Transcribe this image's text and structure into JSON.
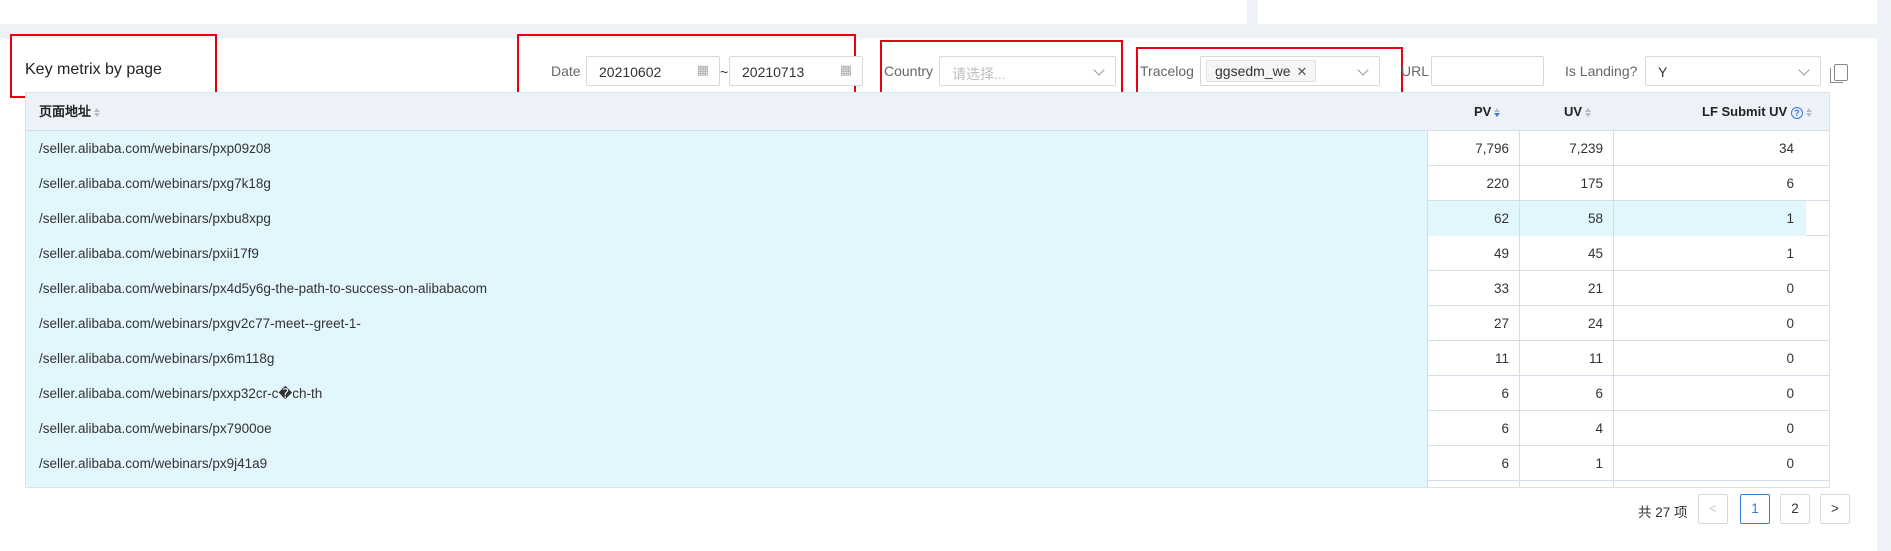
{
  "header": {
    "title": "Key metrix by page"
  },
  "filters": {
    "date_label": "Date",
    "date_from": "20210602",
    "date_separator": "~",
    "date_to": "20210713",
    "country_label": "Country",
    "country_placeholder": "请选择...",
    "tracelog_label": "Tracelog",
    "tracelog_tag": "ggsedm_we",
    "url_label": "URL",
    "url_value": "",
    "landing_label": "Is Landing?",
    "landing_value": "Y"
  },
  "table": {
    "columns": {
      "url": "页面地址",
      "pv": "PV",
      "uv": "UV",
      "lf": "LF Submit UV"
    },
    "rows": [
      {
        "url": "/seller.alibaba.com/webinars/pxp09z08",
        "pv": "7,796",
        "uv": "7,239",
        "lf": "34"
      },
      {
        "url": "/seller.alibaba.com/webinars/pxg7k18g",
        "pv": "220",
        "uv": "175",
        "lf": "6"
      },
      {
        "url": "/seller.alibaba.com/webinars/pxbu8xpg",
        "pv": "62",
        "uv": "58",
        "lf": "1"
      },
      {
        "url": "/seller.alibaba.com/webinars/pxii17f9",
        "pv": "49",
        "uv": "45",
        "lf": "1"
      },
      {
        "url": "/seller.alibaba.com/webinars/px4d5y6g-the-path-to-success-on-alibabacom",
        "pv": "33",
        "uv": "21",
        "lf": "0"
      },
      {
        "url": "/seller.alibaba.com/webinars/pxgv2c77-meet--greet-1-",
        "pv": "27",
        "uv": "24",
        "lf": "0"
      },
      {
        "url": "/seller.alibaba.com/webinars/px6m118g",
        "pv": "11",
        "uv": "11",
        "lf": "0"
      },
      {
        "url": "/seller.alibaba.com/webinars/pxxp32cr-c�ch-th",
        "pv": "6",
        "uv": "6",
        "lf": "0"
      },
      {
        "url": "/seller.alibaba.com/webinars/px7900oe",
        "pv": "6",
        "uv": "4",
        "lf": "0"
      },
      {
        "url": "/seller.alibaba.com/webinars/px9j41a9",
        "pv": "6",
        "uv": "1",
        "lf": "0"
      }
    ]
  },
  "pagination": {
    "total_text": "共 27 项",
    "prev": "<",
    "pages": [
      "1",
      "2"
    ],
    "active_page": "1",
    "next": ">"
  },
  "icons": {
    "calendar": "calendar-icon",
    "chevron": "chevron-down-icon",
    "close": "close-icon",
    "copy": "copy-icon",
    "help": "help-circle-icon"
  },
  "colors": {
    "highlight": "#e60012",
    "accent": "#3a7bd5",
    "url_column_bg": "#e2f6fd"
  }
}
